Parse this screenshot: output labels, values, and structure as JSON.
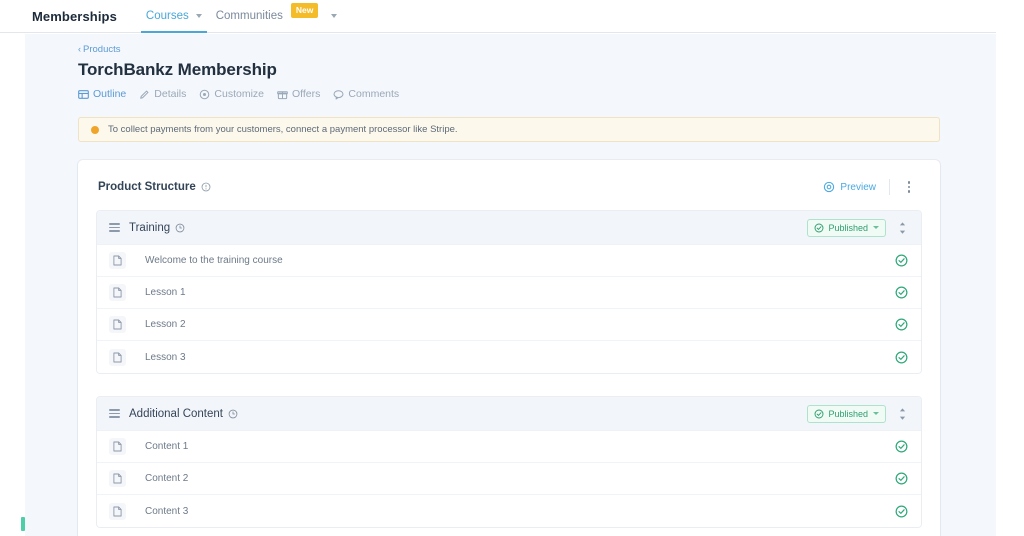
{
  "topnav": {
    "brand": "Memberships",
    "items": [
      {
        "label": "Courses",
        "icon": "chevron-down-icon",
        "active": true,
        "badge": null
      },
      {
        "label": "Communities",
        "icon": "chevron-down-icon",
        "active": false,
        "badge": "New"
      }
    ],
    "trailing_caret": "chevron-down-icon"
  },
  "breadcrumb": {
    "chevron": "‹",
    "label": "Products"
  },
  "page": {
    "title": "TorchBankz Membership"
  },
  "tabs": [
    {
      "label": "Outline",
      "icon": "outline-grid-icon",
      "active": true
    },
    {
      "label": "Details",
      "icon": "pencil-icon",
      "active": false
    },
    {
      "label": "Customize",
      "icon": "palette-icon",
      "active": false
    },
    {
      "label": "Offers",
      "icon": "gift-icon",
      "active": false
    },
    {
      "label": "Comments",
      "icon": "comment-icon",
      "active": false
    }
  ],
  "alert": {
    "icon": "warning-dot-icon",
    "text": "To collect payments from your customers, connect a payment processor like Stripe."
  },
  "card": {
    "title": "Product Structure",
    "title_icon": "info-circle-icon",
    "preview_label": "Preview",
    "preview_icon": "eye-icon",
    "menu_icon": "kebab-menu-icon"
  },
  "sections": [
    {
      "title": "Training",
      "title_icon": "clock-circle-icon",
      "handle_icon": "drag-handle-icon",
      "status": "Published",
      "status_icon": "check-circle-icon",
      "status_caret": "chevron-down-icon",
      "sort_icon": "sort-updown-icon",
      "rows": [
        {
          "label": "Welcome to the training course",
          "icon": "document-icon",
          "status_icon": "check-circle-icon"
        },
        {
          "label": "Lesson 1",
          "icon": "document-icon",
          "status_icon": "check-circle-icon"
        },
        {
          "label": "Lesson 2",
          "icon": "document-icon",
          "status_icon": "check-circle-icon"
        },
        {
          "label": "Lesson 3",
          "icon": "document-icon",
          "status_icon": "check-circle-icon"
        }
      ]
    },
    {
      "title": "Additional Content",
      "title_icon": "clock-circle-icon",
      "handle_icon": "drag-handle-icon",
      "status": "Published",
      "status_icon": "check-circle-icon",
      "status_caret": "chevron-down-icon",
      "sort_icon": "sort-updown-icon",
      "rows": [
        {
          "label": "Content 1",
          "icon": "document-icon",
          "status_icon": "check-circle-icon"
        },
        {
          "label": "Content 2",
          "icon": "document-icon",
          "status_icon": "check-circle-icon"
        },
        {
          "label": "Content 3",
          "icon": "document-icon",
          "status_icon": "check-circle-icon"
        }
      ]
    }
  ],
  "colors": {
    "accent_blue": "#4aa8d8",
    "link_blue": "#5b9bd5",
    "published_green": "#2f9e6e",
    "badge_yellow": "#f5bc2a",
    "alert_bg": "#fdf8ec",
    "page_bg": "#f4f7fc"
  }
}
